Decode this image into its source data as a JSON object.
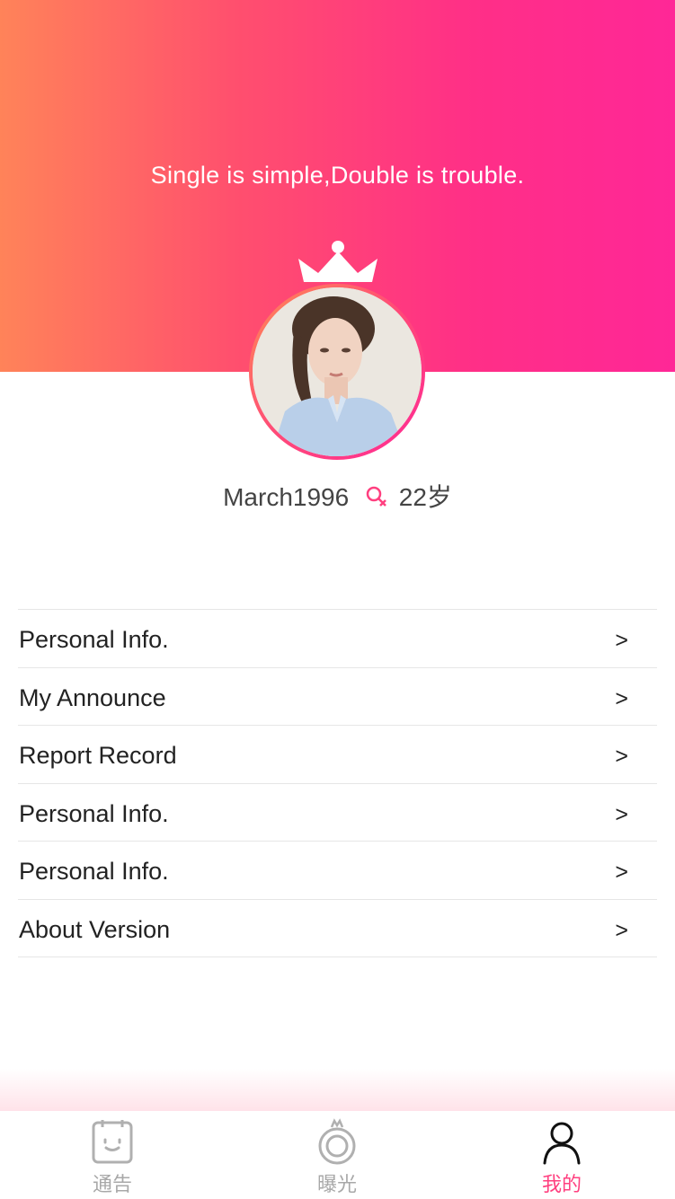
{
  "header": {
    "motto": "Single is simple,Double is trouble."
  },
  "profile": {
    "username": "March1996",
    "gender_icon": "female-icon",
    "age": "22岁"
  },
  "menu": {
    "items": [
      {
        "label": "Personal Info.",
        "arrow": ">"
      },
      {
        "label": "My Announce",
        "arrow": ">"
      },
      {
        "label": "Report Record",
        "arrow": ">"
      },
      {
        "label": "Personal Info.",
        "arrow": ">"
      },
      {
        "label": "Personal Info.",
        "arrow": ">"
      },
      {
        "label": "About Version",
        "arrow": ">"
      }
    ]
  },
  "tabbar": {
    "tabs": [
      {
        "label": "通告",
        "icon": "announcement-icon",
        "active": false
      },
      {
        "label": "曝光",
        "icon": "exposure-icon",
        "active": false
      },
      {
        "label": "我的",
        "icon": "user-icon",
        "active": true
      }
    ]
  },
  "colors": {
    "gradient_start": "#ff8359",
    "gradient_end": "#ff2797",
    "accent": "#ff3f7f",
    "tab_inactive": "#a8a8a8"
  }
}
